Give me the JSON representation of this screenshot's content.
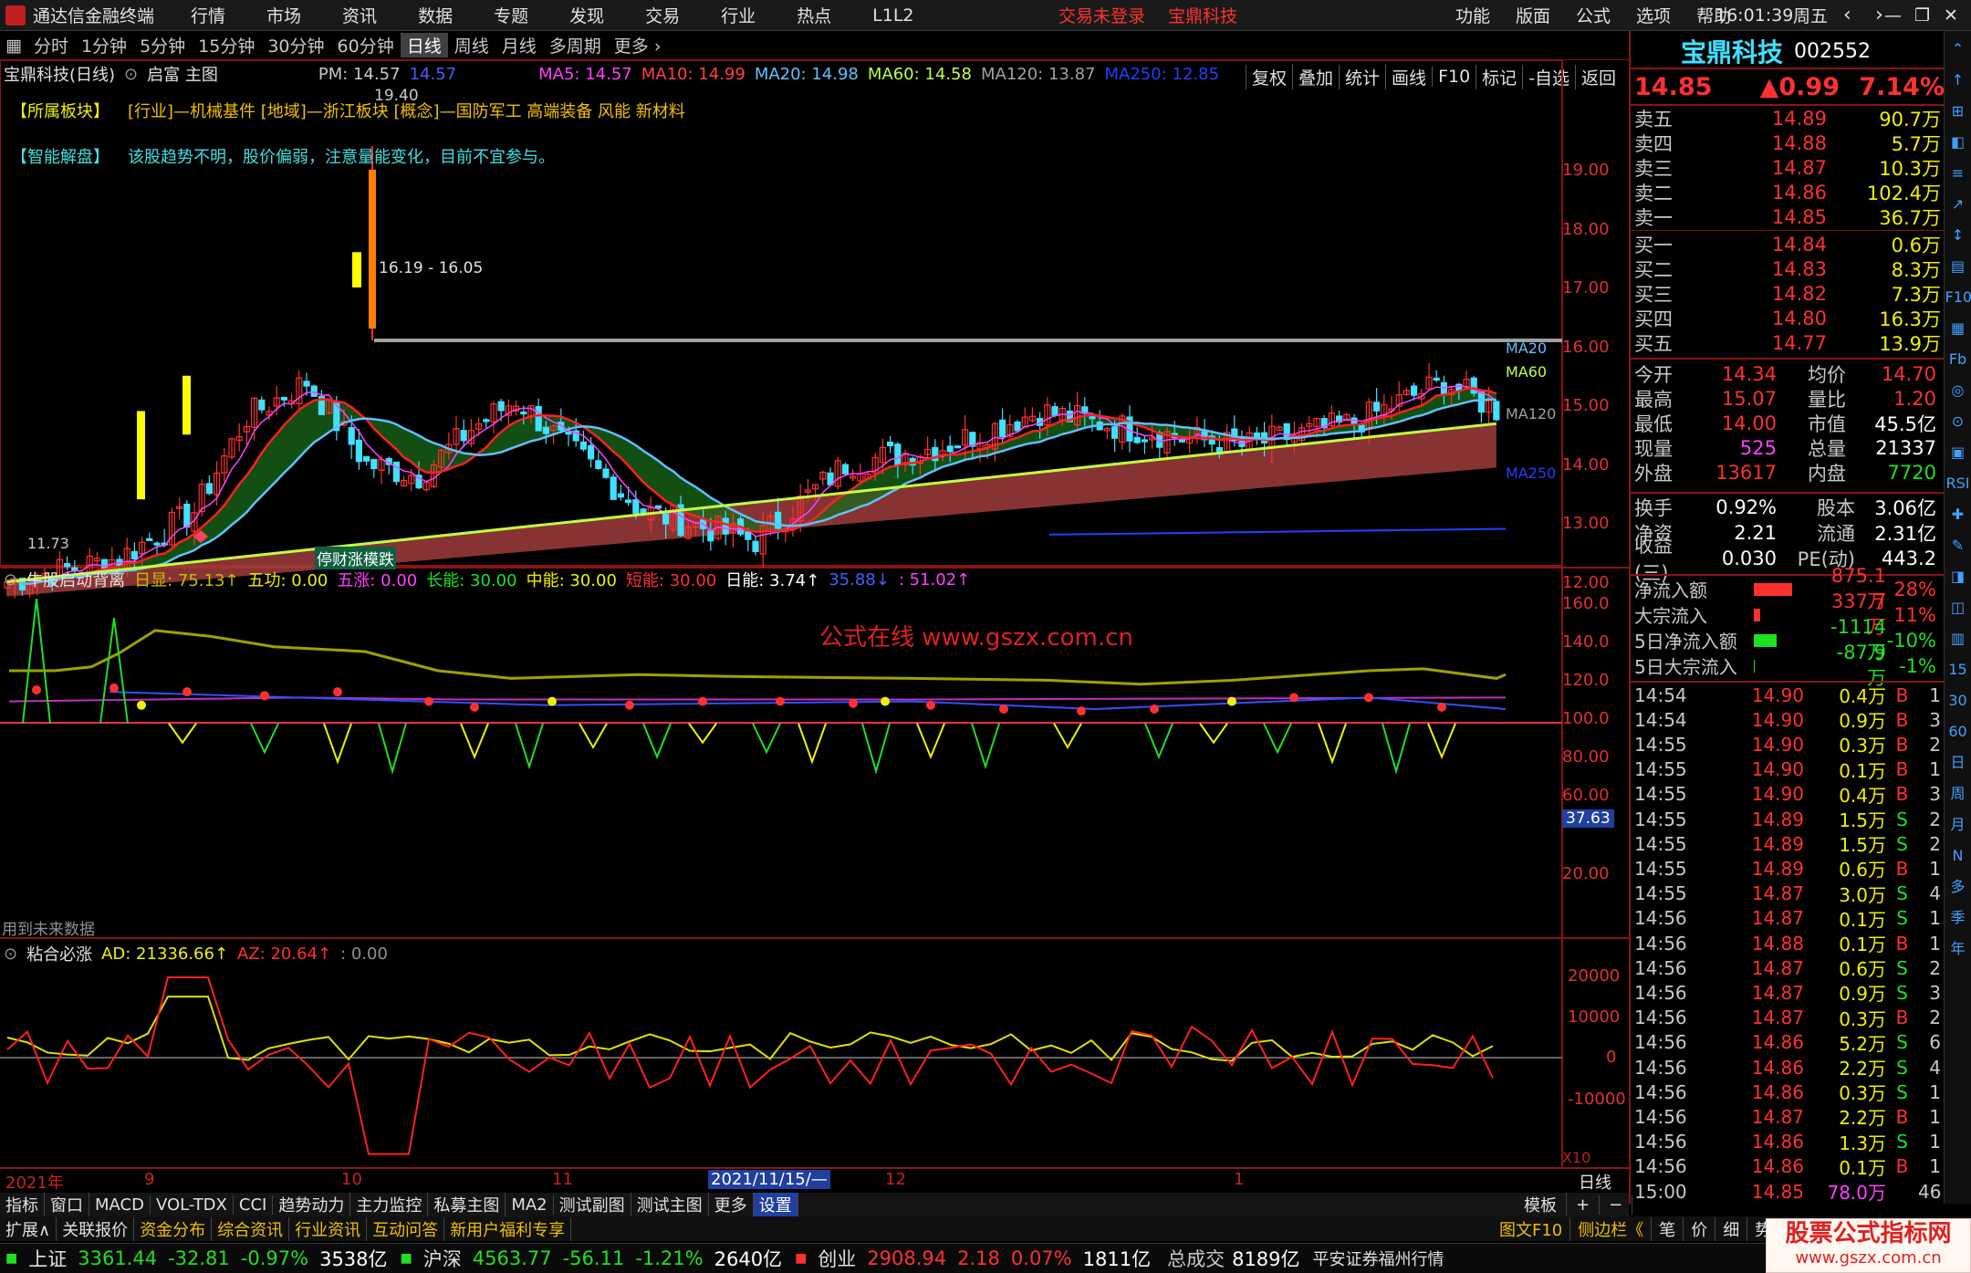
{
  "app": {
    "title": "通达信金融终端",
    "menu": [
      "行情",
      "市场",
      "资讯",
      "数据",
      "专题",
      "发现",
      "交易",
      "行业",
      "热点",
      "L1L2"
    ],
    "login_status": "交易未登录",
    "stock_title": "宝鼎科技",
    "right_menu": [
      "功能",
      "版面",
      "公式",
      "选项",
      "帮助"
    ],
    "time": "16:01:39",
    "weekday": "周五"
  },
  "periods": {
    "items": [
      "分时",
      "1分钟",
      "5分钟",
      "15分钟",
      "30分钟",
      "60分钟",
      "日线",
      "周线",
      "月线",
      "多周期",
      "更多"
    ],
    "active": "日线"
  },
  "tools": [
    "复权",
    "叠加",
    "统计",
    "画线",
    "F10",
    "标记",
    "-自选",
    "返回"
  ],
  "main_chart": {
    "label": "宝鼎科技(日线)",
    "formula": "启富 主图",
    "pm": "PM: 14.57",
    "pm_val": "14.57",
    "ma5": "MA5: 14.57",
    "ma10": "MA10: 14.99",
    "ma20": "MA20: 14.98",
    "ma60": "MA60: 14.58",
    "ma120": "MA120: 13.87",
    "ma250": "MA250: 12.85",
    "sector_label": "【所属板块】",
    "sector_text": "[行业]—机械基件  [地域]—浙江板块  [概念]—国防军工 高端装备 风能 新材料",
    "smart_label": "【智能解盘】",
    "smart_text": "该股趋势不明，股价偏弱，注意量能变化，目前不宜参与。",
    "high_label": "19.40",
    "range_label": "16.19 - 16.05",
    "low_label": "11.73",
    "badge_text": "停财涨模跌",
    "ma_tags": [
      "MA20",
      "MA60",
      "MA120",
      "MA250"
    ],
    "y_ticks": [
      "19.00",
      "18.00",
      "17.00",
      "16.00",
      "15.00",
      "14.00",
      "13.00",
      "12.00"
    ]
  },
  "sub1": {
    "title": "牛股启动背离",
    "items": [
      {
        "t": "日显: 75.13↑",
        "c": "#c0c000"
      },
      {
        "t": "五功: 0.00",
        "c": "#f0f000"
      },
      {
        "t": "五涨: 0.00",
        "c": "#ff40ff"
      },
      {
        "t": "长能: 30.00",
        "c": "#20e020"
      },
      {
        "t": "中能: 30.00",
        "c": "#f0f000"
      },
      {
        "t": "短能: 30.00",
        "c": "#ff3030"
      },
      {
        "t": "日能: 3.74↑",
        "c": "#ffffff"
      },
      {
        "t": "35.88↓",
        "c": "#4060ff"
      },
      {
        "t": ": 51.02↑",
        "c": "#ff40ff"
      }
    ],
    "watermark": "公式在线  www.gszx.com.cn",
    "future_note": "用到未来数据",
    "y_ticks": [
      "160.0",
      "140.0",
      "120.0",
      "100.0",
      "80.00",
      "60.00",
      "20.00"
    ],
    "marker": "37.63"
  },
  "sub2": {
    "title": "粘合必涨",
    "ad": "AD: 21336.66↑",
    "az": "AZ: 20.64↑",
    "extra": ": 0.00",
    "y_ticks": [
      "20000",
      "10000",
      "0",
      "-10000"
    ],
    "x10": "X10"
  },
  "xaxis": {
    "year": "2021年",
    "labels": [
      "9",
      "10",
      "11",
      "12",
      "1"
    ],
    "cursor": "2021/11/15/—",
    "period": "日线"
  },
  "bottom_tabs": [
    "指标",
    "窗口",
    "MACD",
    "VOL-TDX",
    "CCI",
    "趋势动力",
    "主力监控",
    "私募主图",
    "MA2",
    "测试副图",
    "测试主图",
    "更多",
    "设置"
  ],
  "bottom_tab_right": [
    "模板",
    "+",
    "−"
  ],
  "bottom_links": [
    "扩展∧",
    "关联报价",
    "资金分布",
    "综合资讯",
    "行业资讯",
    "互动问答",
    "新用户福利专享"
  ],
  "bottom_links_right": [
    "图文F10",
    "侧边栏《",
    "笔",
    "价",
    "细",
    "势"
  ],
  "quote": {
    "name": "宝鼎科技",
    "code": "002552",
    "price": "14.85",
    "change": "▲0.99",
    "pct": "7.14%",
    "asks": [
      {
        "l": "卖五",
        "p": "14.89",
        "v": "90.7万"
      },
      {
        "l": "卖四",
        "p": "14.88",
        "v": "5.7万"
      },
      {
        "l": "卖三",
        "p": "14.87",
        "v": "10.3万"
      },
      {
        "l": "卖二",
        "p": "14.86",
        "v": "102.4万"
      },
      {
        "l": "卖一",
        "p": "14.85",
        "v": "36.7万"
      }
    ],
    "bids": [
      {
        "l": "买一",
        "p": "14.84",
        "v": "0.6万"
      },
      {
        "l": "买二",
        "p": "14.83",
        "v": "8.3万"
      },
      {
        "l": "买三",
        "p": "14.82",
        "v": "7.3万"
      },
      {
        "l": "买四",
        "p": "14.80",
        "v": "16.3万"
      },
      {
        "l": "买五",
        "p": "14.77",
        "v": "13.9万"
      }
    ],
    "stats": [
      {
        "a": "今开",
        "b": "14.34",
        "bc": "red",
        "c": "均价",
        "d": "14.70",
        "dc": "red"
      },
      {
        "a": "最高",
        "b": "15.07",
        "bc": "red",
        "c": "量比",
        "d": "1.20",
        "dc": "red"
      },
      {
        "a": "最低",
        "b": "14.00",
        "bc": "red",
        "c": "市值",
        "d": "45.5亿",
        "dc": "white"
      },
      {
        "a": "现量",
        "b": "525",
        "bc": "mag",
        "c": "总量",
        "d": "21337",
        "dc": "white"
      },
      {
        "a": "外盘",
        "b": "13617",
        "bc": "red",
        "c": "内盘",
        "d": "7720",
        "dc": "green"
      }
    ],
    "stats2": [
      {
        "a": "换手",
        "b": "0.92%",
        "c": "股本",
        "d": "3.06亿"
      },
      {
        "a": "净资",
        "b": "2.21",
        "c": "流通",
        "d": "2.31亿"
      },
      {
        "a": "收益(三)",
        "b": "0.030",
        "c": "PE(动)",
        "d": "443.2"
      }
    ],
    "flows": [
      {
        "l": "净流入额",
        "v": "875.1万",
        "p": "28%",
        "c": "red",
        "bar": 60
      },
      {
        "l": "大宗流入",
        "v": "337.7万",
        "p": "11%",
        "c": "red",
        "bar": 10
      },
      {
        "l": "5日净流入额",
        "v": "-1114万",
        "p": "-10%",
        "c": "green",
        "bar": 35
      },
      {
        "l": "5日大宗流入",
        "v": "-87.9万",
        "p": "-1%",
        "c": "green",
        "bar": 2
      }
    ],
    "ticks": [
      {
        "t": "14:54",
        "p": "14.90",
        "v": "0.4万",
        "f": "B",
        "n": "1"
      },
      {
        "t": "14:54",
        "p": "14.90",
        "v": "0.9万",
        "f": "B",
        "n": "3"
      },
      {
        "t": "14:55",
        "p": "14.90",
        "v": "0.3万",
        "f": "B",
        "n": "2"
      },
      {
        "t": "14:55",
        "p": "14.90",
        "v": "0.1万",
        "f": "B",
        "n": "1"
      },
      {
        "t": "14:55",
        "p": "14.90",
        "v": "0.4万",
        "f": "B",
        "n": "3"
      },
      {
        "t": "14:55",
        "p": "14.89",
        "v": "1.5万",
        "f": "S",
        "n": "2"
      },
      {
        "t": "14:55",
        "p": "14.89",
        "v": "1.5万",
        "f": "S",
        "n": "2"
      },
      {
        "t": "14:55",
        "p": "14.89",
        "v": "0.6万",
        "f": "B",
        "n": "1"
      },
      {
        "t": "14:55",
        "p": "14.87",
        "v": "3.0万",
        "f": "S",
        "n": "4"
      },
      {
        "t": "14:56",
        "p": "14.87",
        "v": "0.1万",
        "f": "S",
        "n": "1"
      },
      {
        "t": "14:56",
        "p": "14.88",
        "v": "0.1万",
        "f": "B",
        "n": "1"
      },
      {
        "t": "14:56",
        "p": "14.87",
        "v": "0.6万",
        "f": "S",
        "n": "2"
      },
      {
        "t": "14:56",
        "p": "14.87",
        "v": "0.9万",
        "f": "S",
        "n": "3"
      },
      {
        "t": "14:56",
        "p": "14.87",
        "v": "0.3万",
        "f": "B",
        "n": "2"
      },
      {
        "t": "14:56",
        "p": "14.86",
        "v": "5.2万",
        "f": "S",
        "n": "6"
      },
      {
        "t": "14:56",
        "p": "14.86",
        "v": "2.2万",
        "f": "S",
        "n": "4"
      },
      {
        "t": "14:56",
        "p": "14.86",
        "v": "0.3万",
        "f": "S",
        "n": "1"
      },
      {
        "t": "14:56",
        "p": "14.87",
        "v": "2.2万",
        "f": "B",
        "n": "1"
      },
      {
        "t": "14:56",
        "p": "14.86",
        "v": "1.3万",
        "f": "S",
        "n": "1"
      },
      {
        "t": "14:56",
        "p": "14.86",
        "v": "0.1万",
        "f": "B",
        "n": "1"
      },
      {
        "t": "15:00",
        "p": "14.85",
        "v": "78.0万",
        "f": "",
        "n": "46"
      }
    ]
  },
  "right_icons": [
    "⌃",
    "↑",
    "⊞",
    "◧",
    "≡",
    "↗",
    "↕",
    "▤",
    "F10",
    "▦",
    "Fb",
    "◎",
    "⊙",
    "▣",
    "RSI",
    "✚",
    "✎",
    "◨",
    "◫",
    "▥",
    "15",
    "30",
    "60",
    "日",
    "周",
    "月",
    "N",
    "多",
    "季",
    "年"
  ],
  "indexbar": {
    "items": [
      {
        "name": "上证",
        "val": "3361.44",
        "chg": "-32.81",
        "pct": "-0.97%",
        "amt": "3538亿",
        "c": "green"
      },
      {
        "name": "沪深",
        "val": "4563.77",
        "chg": "-56.11",
        "pct": "-1.21%",
        "amt": "2640亿",
        "c": "green"
      },
      {
        "name": "创业",
        "val": "2908.94",
        "chg": "2.18",
        "pct": "0.07%",
        "amt": "1811亿",
        "c": "red"
      }
    ],
    "total_label": "总成交",
    "total": "8189亿",
    "broker": "平安证券福州行情",
    "brand": "股票公式指标网",
    "brand_url": "www.gszx.com.cn"
  }
}
